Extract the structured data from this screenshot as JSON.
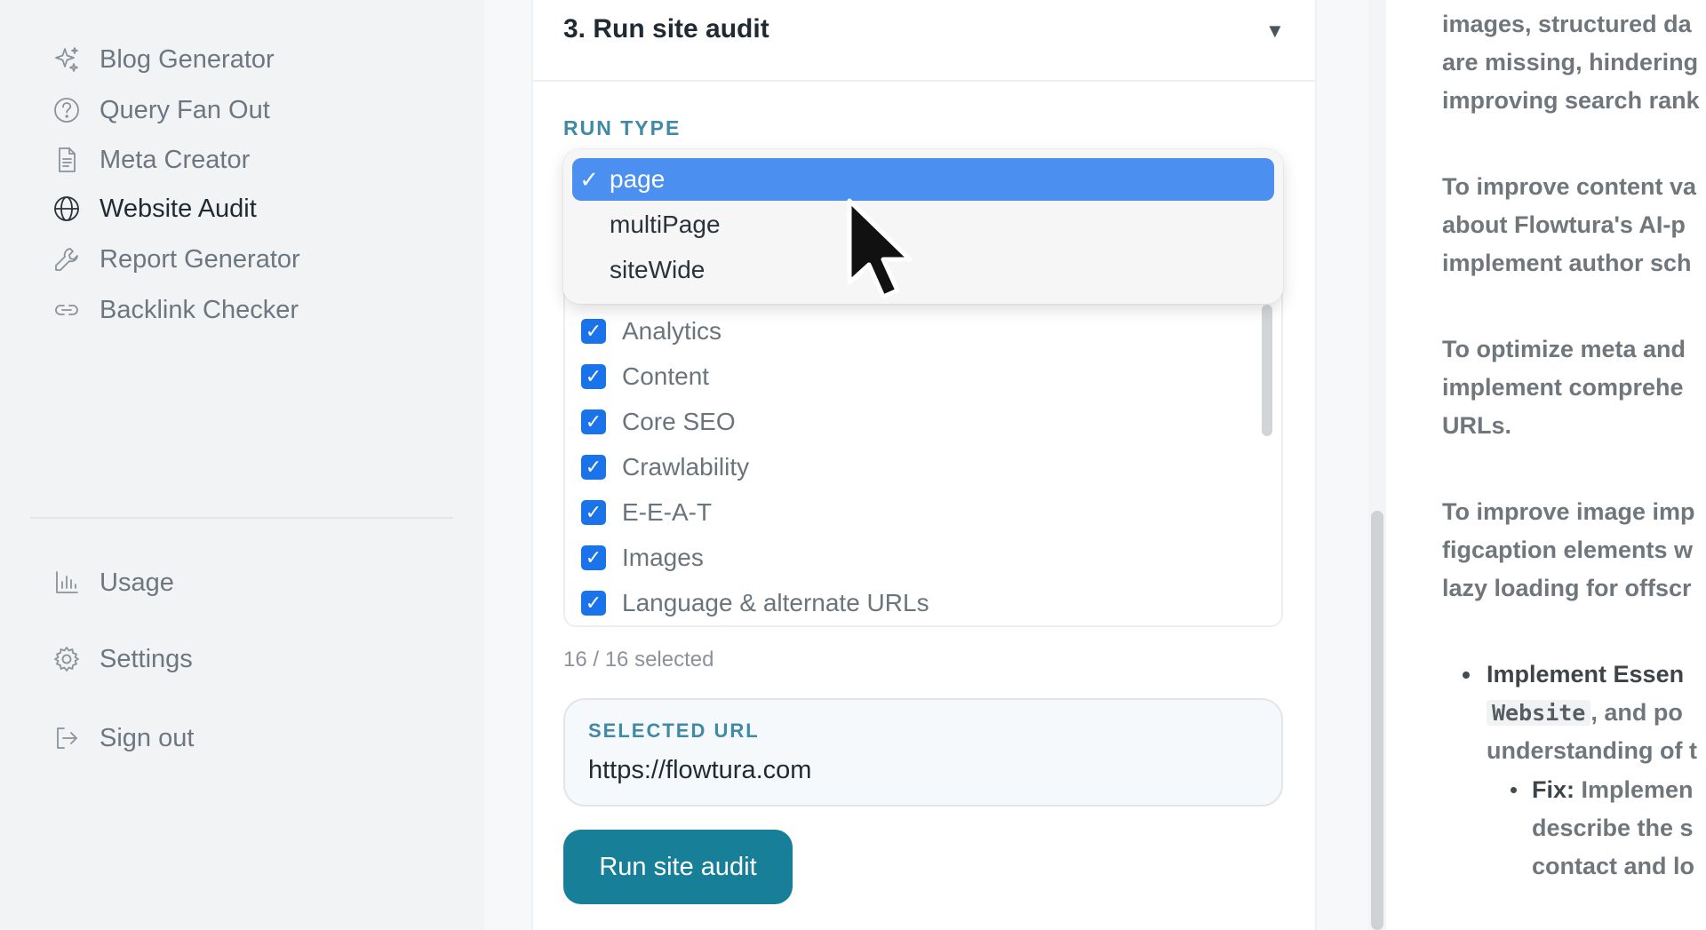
{
  "sidebar": {
    "items": [
      {
        "label": "Blog Generator",
        "icon": "sparkles-icon"
      },
      {
        "label": "Query Fan Out",
        "icon": "help-circle-icon"
      },
      {
        "label": "Meta Creator",
        "icon": "document-icon"
      },
      {
        "label": "Website Audit",
        "icon": "globe-icon",
        "active": true
      },
      {
        "label": "Report Generator",
        "icon": "wrench-icon"
      },
      {
        "label": "Backlink Checker",
        "icon": "link-icon"
      }
    ],
    "secondary": [
      {
        "label": "Usage",
        "icon": "bar-chart-icon"
      },
      {
        "label": "Settings",
        "icon": "gear-icon"
      },
      {
        "label": "Sign out",
        "icon": "sign-out-icon"
      }
    ]
  },
  "main": {
    "section_title": "3. Run site audit",
    "run_type_label": "RUN TYPE",
    "run_type_options": [
      {
        "label": "page",
        "selected": true,
        "check": "✓"
      },
      {
        "label": "multiPage",
        "selected": false
      },
      {
        "label": "siteWide",
        "selected": false
      }
    ],
    "checks": [
      "Analytics",
      "Content",
      "Core SEO",
      "Crawlability",
      "E-E-A-T",
      "Images",
      "Language & alternate URLs"
    ],
    "selected_count": "16 / 16 selected",
    "selected_url_label": "SELECTED URL",
    "selected_url": "https://flowtura.com",
    "run_button": "Run site audit"
  },
  "report": {
    "lines": [
      "images, structured da",
      "are missing, hindering",
      "improving search rank",
      "To improve content va",
      "about Flowtura's AI-p",
      "implement author sch",
      "To optimize meta and",
      "implement comprehe",
      "URLs.",
      "To improve image imp",
      "figcaption elements w",
      "lazy loading for offscr"
    ],
    "bullet_title": "Implement Essen",
    "bullet_code": "Website",
    "bullet_rest": ", and po",
    "bullet_line3": "understanding of t",
    "fix_label": "Fix:",
    "fix_rest": " Implemen",
    "fix_line2": "describe the s",
    "fix_line3": "contact and lo"
  },
  "colors": {
    "accent": "#177f97",
    "checkbox": "#1a73e8",
    "selected_option": "#4b8ff0",
    "label": "#3f8aa6"
  }
}
